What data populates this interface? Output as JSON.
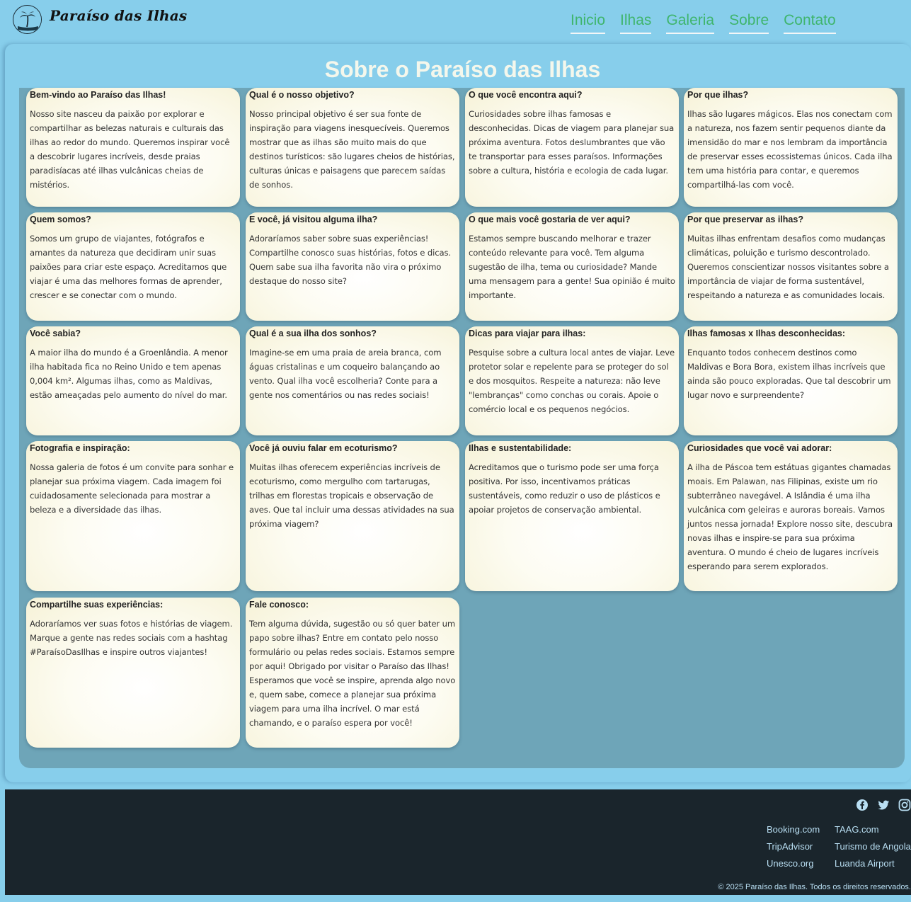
{
  "brand": {
    "name": "Paraíso das Ilhas",
    "logo_icon": "palm-island-icon"
  },
  "nav": {
    "items": [
      {
        "label": "Inicio"
      },
      {
        "label": "Ilhas"
      },
      {
        "label": "Galeria"
      },
      {
        "label": "Sobre"
      },
      {
        "label": "Contato"
      }
    ]
  },
  "page": {
    "title": "Sobre o Paraíso das Ilhas"
  },
  "cards": [
    {
      "title": "Bem-vindo ao Paraíso das Ilhas!",
      "text": "Nosso site nasceu da paixão por explorar e compartilhar as belezas naturais e culturais das ilhas ao redor do mundo. Queremos inspirar você a descobrir lugares incríveis, desde praias paradisíacas até ilhas vulcânicas cheias de mistérios."
    },
    {
      "title": "Qual é o nosso objetivo?",
      "text": "Nosso principal objetivo é ser sua fonte de inspiração para viagens inesquecíveis. Queremos mostrar que as ilhas são muito mais do que destinos turísticos: são lugares cheios de histórias, culturas únicas e paisagens que parecem saídas de sonhos."
    },
    {
      "title": "O que você encontra aqui?",
      "text": "Curiosidades sobre ilhas famosas e desconhecidas. Dicas de viagem para planejar sua próxima aventura. Fotos deslumbrantes que vão te transportar para esses paraísos. Informações sobre a cultura, história e ecologia de cada lugar."
    },
    {
      "title": "Por que ilhas?",
      "text": "Ilhas são lugares mágicos. Elas nos conectam com a natureza, nos fazem sentir pequenos diante da imensidão do mar e nos lembram da importância de preservar esses ecossistemas únicos. Cada ilha tem uma história para contar, e queremos compartilhá-las com você."
    },
    {
      "title": "Quem somos?",
      "text": "Somos um grupo de viajantes, fotógrafos e amantes da natureza que decidiram unir suas paixões para criar este espaço. Acreditamos que viajar é uma das melhores formas de aprender, crescer e se conectar com o mundo."
    },
    {
      "title": "E você, já visitou alguma ilha?",
      "text": "Adoraríamos saber sobre suas experiências! Compartilhe conosco suas histórias, fotos e dicas. Quem sabe sua ilha favorita não vira o próximo destaque do nosso site?"
    },
    {
      "title": "O que mais você gostaria de ver aqui?",
      "text": "Estamos sempre buscando melhorar e trazer conteúdo relevante para você. Tem alguma sugestão de ilha, tema ou curiosidade? Mande uma mensagem para a gente! Sua opinião é muito importante."
    },
    {
      "title": "Por que preservar as ilhas?",
      "text": "Muitas ilhas enfrentam desafios como mudanças climáticas, poluição e turismo descontrolado. Queremos conscientizar nossos visitantes sobre a importância de viajar de forma sustentável, respeitando a natureza e as comunidades locais."
    },
    {
      "title": "Você sabia?",
      "text": "A maior ilha do mundo é a Groenlândia. A menor ilha habitada fica no Reino Unido e tem apenas 0,004 km². Algumas ilhas, como as Maldivas, estão ameaçadas pelo aumento do nível do mar."
    },
    {
      "title": "Qual é a sua ilha dos sonhos?",
      "text": "Imagine-se em uma praia de areia branca, com águas cristalinas e um coqueiro balançando ao vento. Qual ilha você escolheria? Conte para a gente nos comentários ou nas redes sociais!"
    },
    {
      "title": "Dicas para viajar para ilhas:",
      "text": "Pesquise sobre a cultura local antes de viajar. Leve protetor solar e repelente para se proteger do sol e dos mosquitos. Respeite a natureza: não leve \"lembranças\" como conchas ou corais. Apoie o comércio local e os pequenos negócios."
    },
    {
      "title": "Ilhas famosas x Ilhas desconhecidas:",
      "text": "Enquanto todos conhecem destinos como Maldivas e Bora Bora, existem ilhas incríveis que ainda são pouco exploradas. Que tal descobrir um lugar novo e surpreendente?"
    },
    {
      "title": "Fotografia e inspiração:",
      "text": "Nossa galeria de fotos é um convite para sonhar e planejar sua próxima viagem. Cada imagem foi cuidadosamente selecionada para mostrar a beleza e a diversidade das ilhas."
    },
    {
      "title": "Você já ouviu falar em ecoturismo?",
      "text": "Muitas ilhas oferecem experiências incríveis de ecoturismo, como mergulho com tartarugas, trilhas em florestas tropicais e observação de aves. Que tal incluir uma dessas atividades na sua próxima viagem?"
    },
    {
      "title": "Ilhas e sustentabilidade:",
      "text": "Acreditamos que o turismo pode ser uma força positiva. Por isso, incentivamos práticas sustentáveis, como reduzir o uso de plásticos e apoiar projetos de conservação ambiental."
    },
    {
      "title": "Curiosidades que você vai adorar:",
      "text": "A ilha de Páscoa tem estátuas gigantes chamadas moais. Em Palawan, nas Filipinas, existe um rio subterrâneo navegável. A Islândia é uma ilha vulcânica com geleiras e auroras boreais. Vamos juntos nessa jornada! Explore nosso site, descubra novas ilhas e inspire-se para sua próxima aventura. O mundo é cheio de lugares incríveis esperando para serem explorados."
    },
    {
      "title": "Compartilhe suas experiências:",
      "text": "Adoraríamos ver suas fotos e histórias de viagem. Marque a gente nas redes sociais com a hashtag #ParaísoDasIlhas e inspire outros viajantes!"
    },
    {
      "title": "Fale conosco:",
      "text": "Tem alguma dúvida, sugestão ou só quer bater um papo sobre ilhas? Entre em contato pelo nosso formulário ou pelas redes sociais. Estamos sempre por aqui! Obrigado por visitar o Paraíso das Ilhas! Esperamos que você se inspire, aprenda algo novo e, quem sabe, comece a planejar sua próxima viagem para uma ilha incrível. O mar está chamando, e o paraíso espera por você!"
    }
  ],
  "footer": {
    "social": [
      "facebook-icon",
      "twitter-icon",
      "instagram-icon"
    ],
    "links": [
      "Booking.com",
      "TAAG.com",
      "TripAdvisor",
      "Turismo de Angola",
      "Unesco.org",
      "Luanda Airport"
    ],
    "copyright": "© 2025 Paraíso das Ilhas. Todos os direitos reservados."
  },
  "colors": {
    "nav_link": "#3fb56d",
    "background": "#87ceeb",
    "grid_bg": "#6ea5b8",
    "footer_bg": "#1a252c",
    "footer_link": "#b9dff3",
    "title": "#f4f7ec"
  }
}
